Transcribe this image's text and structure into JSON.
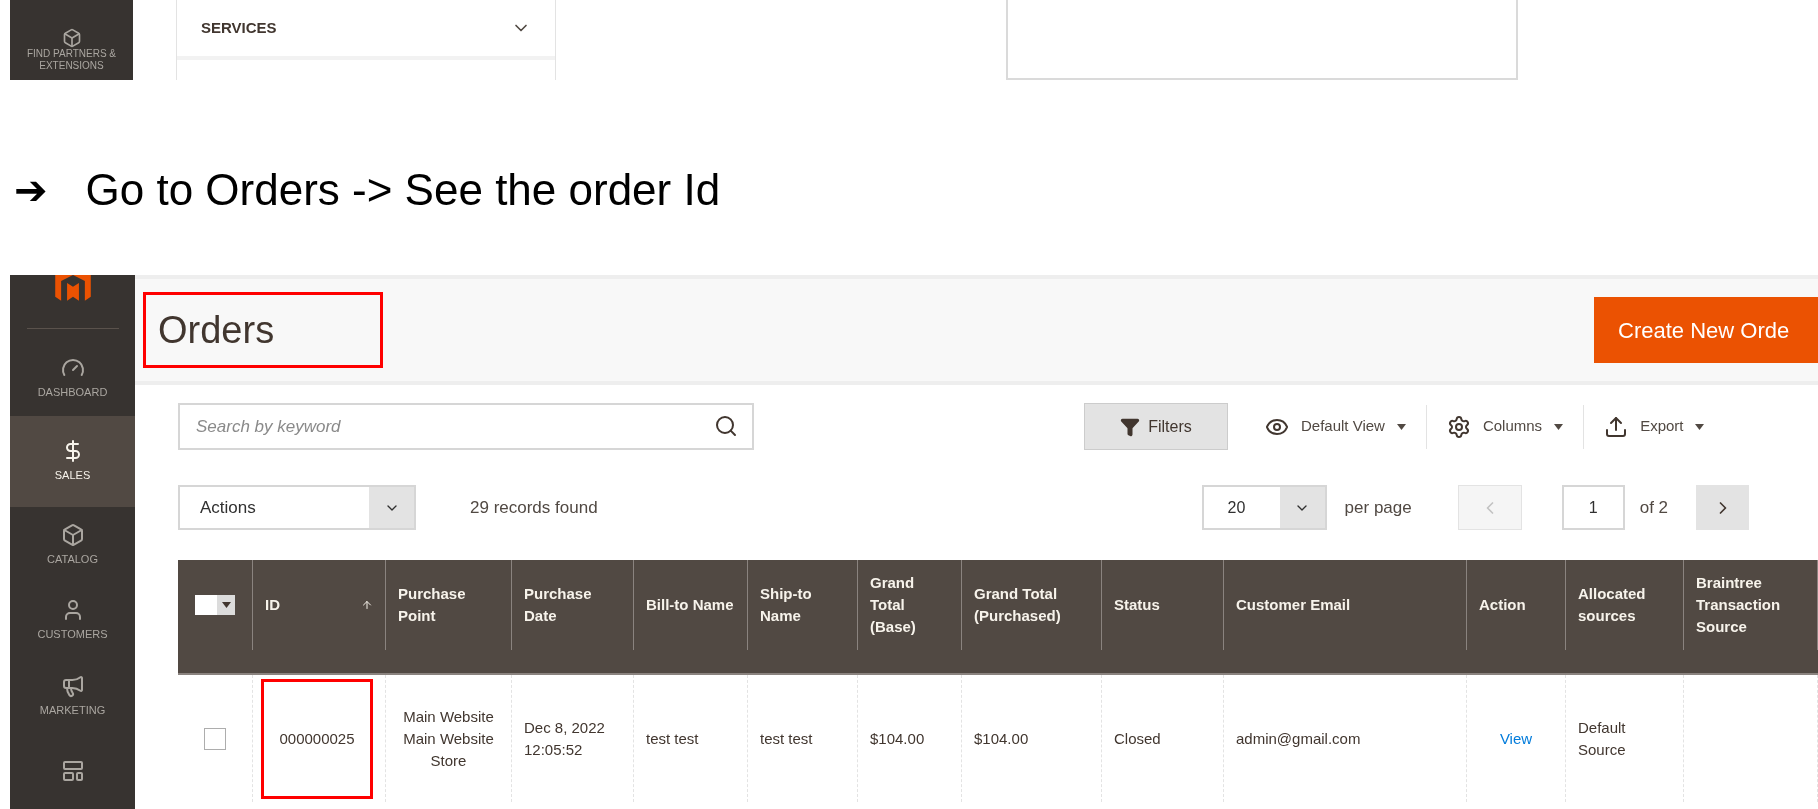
{
  "top_crop": {
    "sidebar_item": {
      "label": "FIND PARTNERS & EXTENSIONS"
    },
    "services": {
      "label": "SERVICES"
    }
  },
  "instruction": {
    "bullet": "➔",
    "text": "Go to Orders -> See the order Id"
  },
  "admin": {
    "sidebar": {
      "items": [
        {
          "label": "DASHBOARD",
          "selected": false
        },
        {
          "label": "SALES",
          "selected": true
        },
        {
          "label": "CATALOG",
          "selected": false
        },
        {
          "label": "CUSTOMERS",
          "selected": false
        },
        {
          "label": "MARKETING",
          "selected": false
        },
        {
          "selected": false
        }
      ]
    },
    "page_title": {
      "text": "Orders",
      "highlighted": true
    },
    "create_button": "Create New Orde",
    "search": {
      "placeholder": "Search by keyword"
    },
    "filters_button": "Filters",
    "toolbar": [
      {
        "label": "Default View"
      },
      {
        "label": "Columns"
      },
      {
        "label": "Export"
      }
    ],
    "actions_select": "Actions",
    "records_found": "29 records found",
    "per_page": {
      "value": "20",
      "label": "per page"
    },
    "pager": {
      "page": "1",
      "total": "of 2"
    },
    "table": {
      "columns": [
        "ID",
        "Purchase Point",
        "Purchase Date",
        "Bill-to Name",
        "Ship-to Name",
        "Grand Total (Base)",
        "Grand Total (Purchased)",
        "Status",
        "Customer Email",
        "Action",
        "Allocated sources",
        "Braintree Transaction Source"
      ],
      "select_all_checked": false,
      "rows": [
        {
          "checked": false,
          "id": "000000025",
          "id_highlighted": true,
          "purchase_point": [
            "Main Website",
            "Main Website Store"
          ],
          "purchase_date": "Dec 8, 2022 12:05:52",
          "bill_to": "test test",
          "ship_to": "test test",
          "grand_total_base": "$104.00",
          "grand_total_purchased": "$104.00",
          "status": "Closed",
          "email": "admin@gmail.com",
          "action": "View",
          "allocated_sources": "Default Source"
        }
      ]
    }
  }
}
